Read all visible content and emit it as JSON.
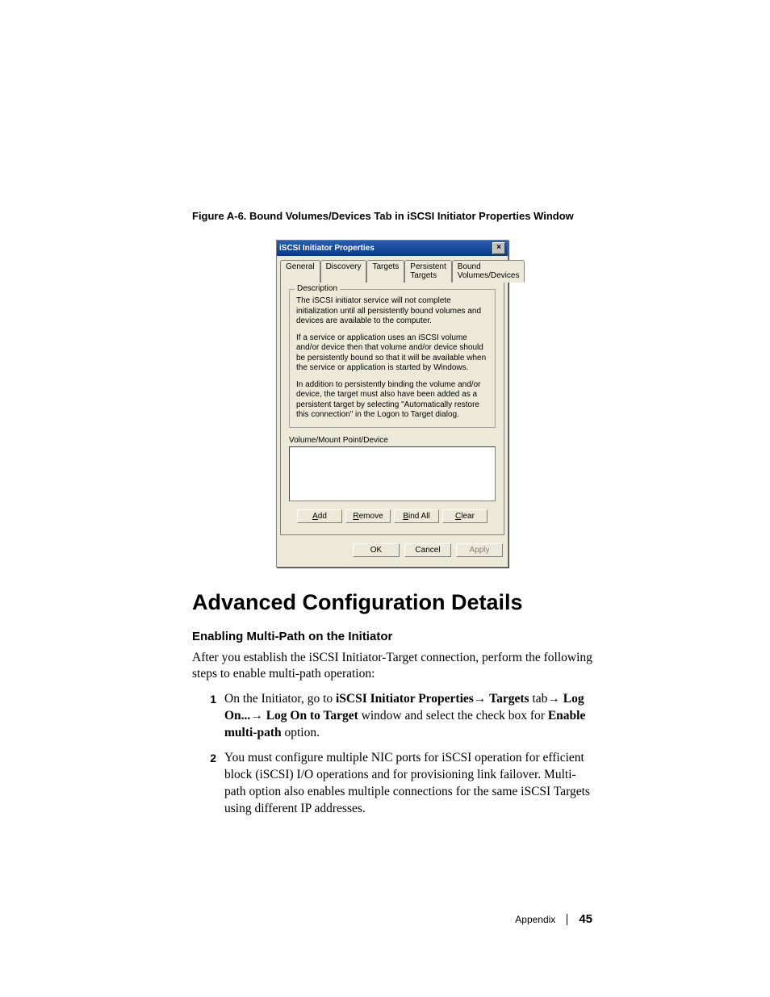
{
  "figure_caption": "Figure A-6.    Bound Volumes/Devices Tab in iSCSI Initiator Properties Window",
  "dialog": {
    "title": "iSCSI Initiator Properties",
    "close_glyph": "×",
    "tabs": [
      "General",
      "Discovery",
      "Targets",
      "Persistent Targets",
      "Bound Volumes/Devices"
    ],
    "active_tab_index": 4,
    "description_legend": "Description",
    "desc_p1": "The iSCSI initiator service will not complete initialization until all persistently bound volumes and devices are available to the computer.",
    "desc_p2": "If a service or application uses an iSCSI volume and/or device then that volume and/or device should be persistently bound so that it will be available when the service or application is started by Windows.",
    "desc_p3": "In addition to persistently binding the volume and/or device, the target must also have been added as a persistent target by selecting \"Automatically restore this connection\" in the Logon to Target dialog.",
    "list_label": "Volume/Mount Point/Device",
    "buttons": {
      "add": "Add",
      "remove": "Remove",
      "bind_all": "Bind All",
      "clear": "Clear",
      "ok": "OK",
      "cancel": "Cancel",
      "apply": "Apply"
    }
  },
  "section_heading": "Advanced Configuration Details",
  "subsection_heading": "Enabling Multi-Path on the Initiator",
  "intro_para": "After you establish the iSCSI Initiator-Target connection, perform the following steps to enable multi-path operation:",
  "step1": {
    "t1": "On the Initiator, go to ",
    "b1": "iSCSI Initiator Properties",
    "arrow1": "→ ",
    "b2": "Targets",
    "t2": " tab",
    "arrow2": "→ ",
    "b3": "Log On...",
    "arrow3": "→ ",
    "b4": "Log On to Target",
    "t3": " window and select the check box for ",
    "b5": "Enable multi-path",
    "t4": " option."
  },
  "step2_text": "You must configure multiple NIC ports for iSCSI operation for efficient block (iSCSI) I/O operations and for provisioning link failover. Multi-path option also enables multiple connections for the same iSCSI Targets using different IP addresses.",
  "footer": {
    "label": "Appendix",
    "page": "45"
  }
}
